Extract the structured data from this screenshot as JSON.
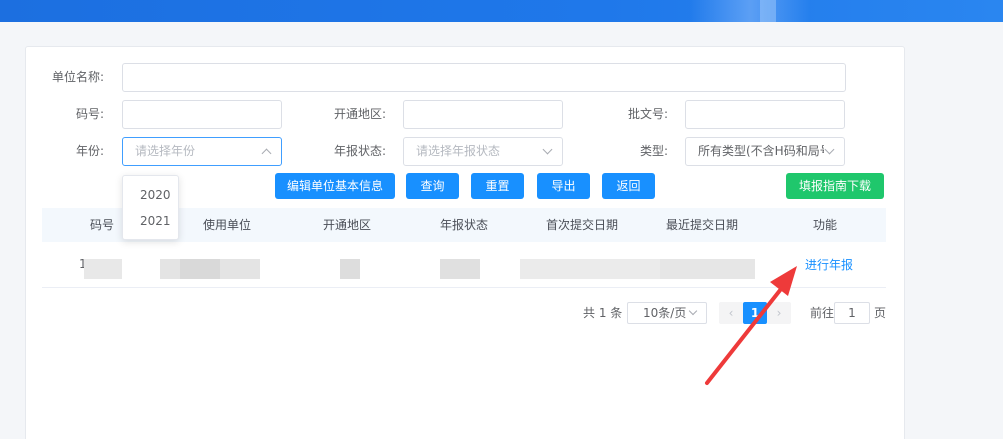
{
  "filters": {
    "unit_name_label": "单位名称:",
    "code_label": "码号:",
    "region_label": "开通地区:",
    "approval_label": "批文号:",
    "year_label": "年份:",
    "year_placeholder": "请选择年份",
    "report_status_label": "年报状态:",
    "report_status_placeholder": "请选择年报状态",
    "type_label": "类型:",
    "type_value": "所有类型(不含H码和局号"
  },
  "year_dropdown": {
    "options": [
      "2020",
      "2021"
    ]
  },
  "buttons": {
    "edit_unit": "编辑单位基本信息",
    "query": "查询",
    "reset": "重置",
    "export": "导出",
    "back": "返回",
    "guide_download": "填报指南下载"
  },
  "table": {
    "columns": [
      "码号",
      "使用单位",
      "开通地区",
      "年报状态",
      "首次提交日期",
      "最近提交日期",
      "功能"
    ],
    "row_prefix": "1",
    "row_action": "进行年报"
  },
  "pagination": {
    "total_text": "共 1 条",
    "page_size": "10条/页",
    "current_page": "1",
    "goto_label": "前往",
    "goto_value": "1",
    "page_suffix": "页"
  },
  "colors": {
    "primary": "#1890ff",
    "success": "#1fc76c",
    "annotation": "#ee3a3a"
  }
}
